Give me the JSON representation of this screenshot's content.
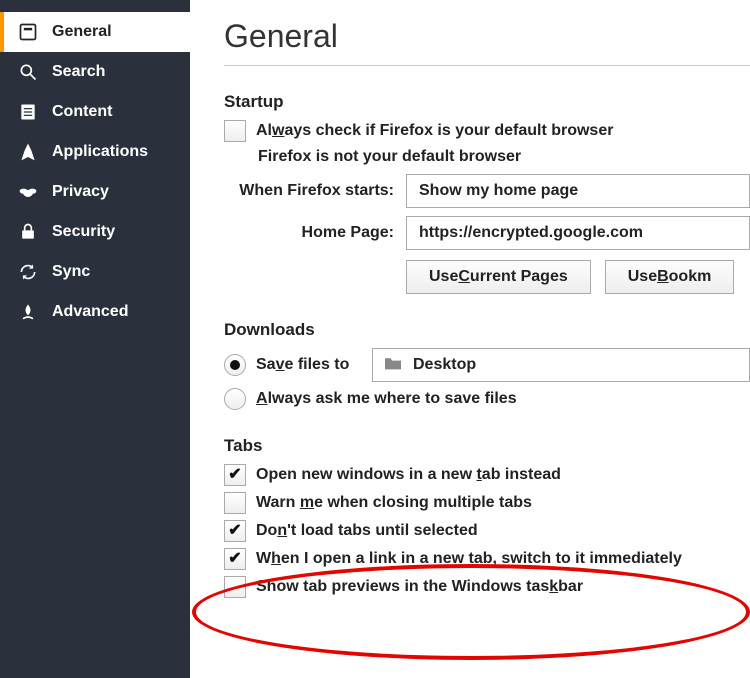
{
  "sidebar": {
    "items": [
      {
        "label": "General",
        "icon": "general-icon",
        "active": true
      },
      {
        "label": "Search",
        "icon": "search-icon",
        "active": false
      },
      {
        "label": "Content",
        "icon": "content-icon",
        "active": false
      },
      {
        "label": "Applications",
        "icon": "applications-icon",
        "active": false
      },
      {
        "label": "Privacy",
        "icon": "privacy-icon",
        "active": false
      },
      {
        "label": "Security",
        "icon": "security-icon",
        "active": false
      },
      {
        "label": "Sync",
        "icon": "sync-icon",
        "active": false
      },
      {
        "label": "Advanced",
        "icon": "advanced-icon",
        "active": false
      }
    ]
  },
  "page": {
    "title": "General"
  },
  "startup": {
    "heading": "Startup",
    "always_check_label": "Always check if Firefox is your default browser",
    "always_check_checked": false,
    "not_default_text": "Firefox is not your default browser",
    "when_starts_label": "When Firefox starts:",
    "when_starts_value": "Show my home page",
    "home_page_label": "Home Page:",
    "home_page_value": "https://encrypted.google.com",
    "btn_current": "Use Current Pages",
    "btn_bookmark": "Use Bookm"
  },
  "downloads": {
    "heading": "Downloads",
    "save_to_label": "Save files to",
    "save_to_selected": true,
    "folder": "Desktop",
    "always_ask_label": "Always ask me where to save files",
    "always_ask_selected": false
  },
  "tabs": {
    "heading": "Tabs",
    "items": [
      {
        "label": "Open new windows in a new tab instead",
        "checked": true
      },
      {
        "label": "Warn me when closing multiple tabs",
        "checked": false
      },
      {
        "label": "Don't load tabs until selected",
        "checked": true
      },
      {
        "label": "When I open a link in a new tab, switch to it immediately",
        "checked": true
      },
      {
        "label": "Show tab previews in the Windows taskbar",
        "checked": false
      }
    ]
  },
  "annotation": {
    "highlighted_option_index": 3
  }
}
